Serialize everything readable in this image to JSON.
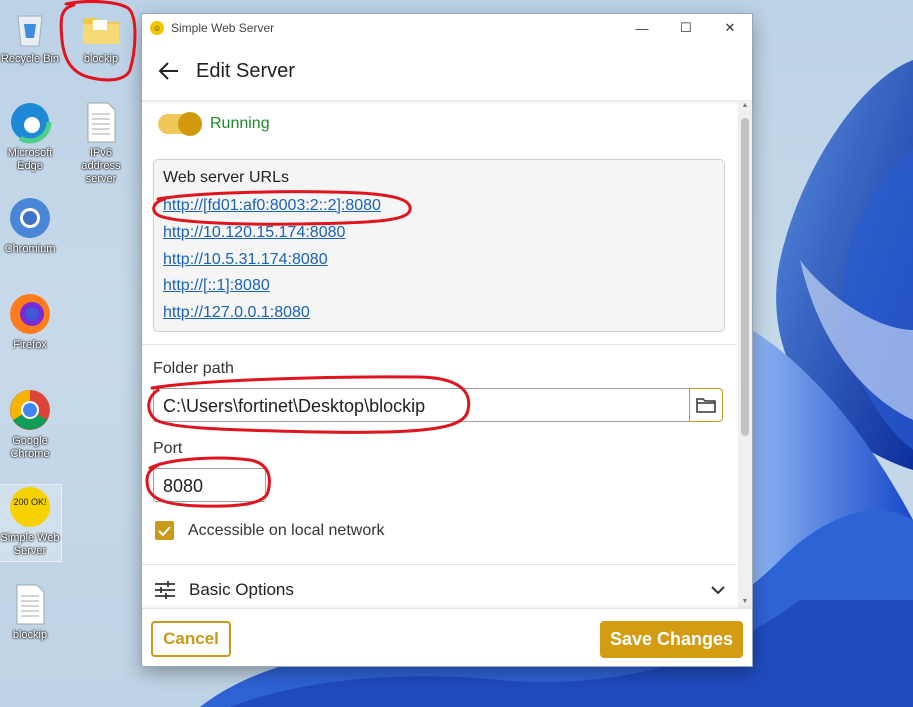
{
  "desktop": {
    "icons": [
      {
        "label": "Recycle Bin",
        "icon": "recycle-bin-icon"
      },
      {
        "label": "blockip",
        "icon": "folder-icon"
      },
      {
        "label": "Microsoft Edge",
        "icon": "edge-icon"
      },
      {
        "label": "IPv6 address server",
        "icon": "document-icon"
      },
      {
        "label": "Chromium",
        "icon": "chromium-icon"
      },
      {
        "label": "Firefox",
        "icon": "firefox-icon"
      },
      {
        "label": "Google Chrome",
        "icon": "chrome-icon"
      },
      {
        "label": "Simple Web Server",
        "icon": "simple-web-server-icon",
        "badge": "200 OK!"
      },
      {
        "label": "blockip",
        "icon": "document-icon"
      }
    ]
  },
  "window": {
    "title": "Simple Web Server",
    "controls": {
      "minimize": "—",
      "maximize": "☐",
      "close": "✕"
    },
    "header_title": "Edit Server",
    "status": {
      "label": "Running",
      "enabled": true,
      "color": "#1f8a2a"
    },
    "urls": {
      "title": "Web server URLs",
      "links": [
        "http://[fd01:af0:8003:2::2]:8080",
        "http://10.120.15.174:8080",
        "http://10.5.31.174:8080",
        "http://[::1]:8080",
        "http://127.0.0.1:8080"
      ]
    },
    "folder": {
      "label": "Folder path",
      "value": "C:\\Users\\fortinet\\Desktop\\blockip"
    },
    "port": {
      "label": "Port",
      "value": "8080"
    },
    "local_network": {
      "label": "Accessible on local network",
      "checked": true
    },
    "basic_options": {
      "label": "Basic Options"
    },
    "footer": {
      "cancel": "Cancel",
      "save": "Save Changes"
    }
  },
  "colors": {
    "accent": "#d39c12",
    "link": "#1a62b5",
    "annotation": "#e0141e"
  }
}
